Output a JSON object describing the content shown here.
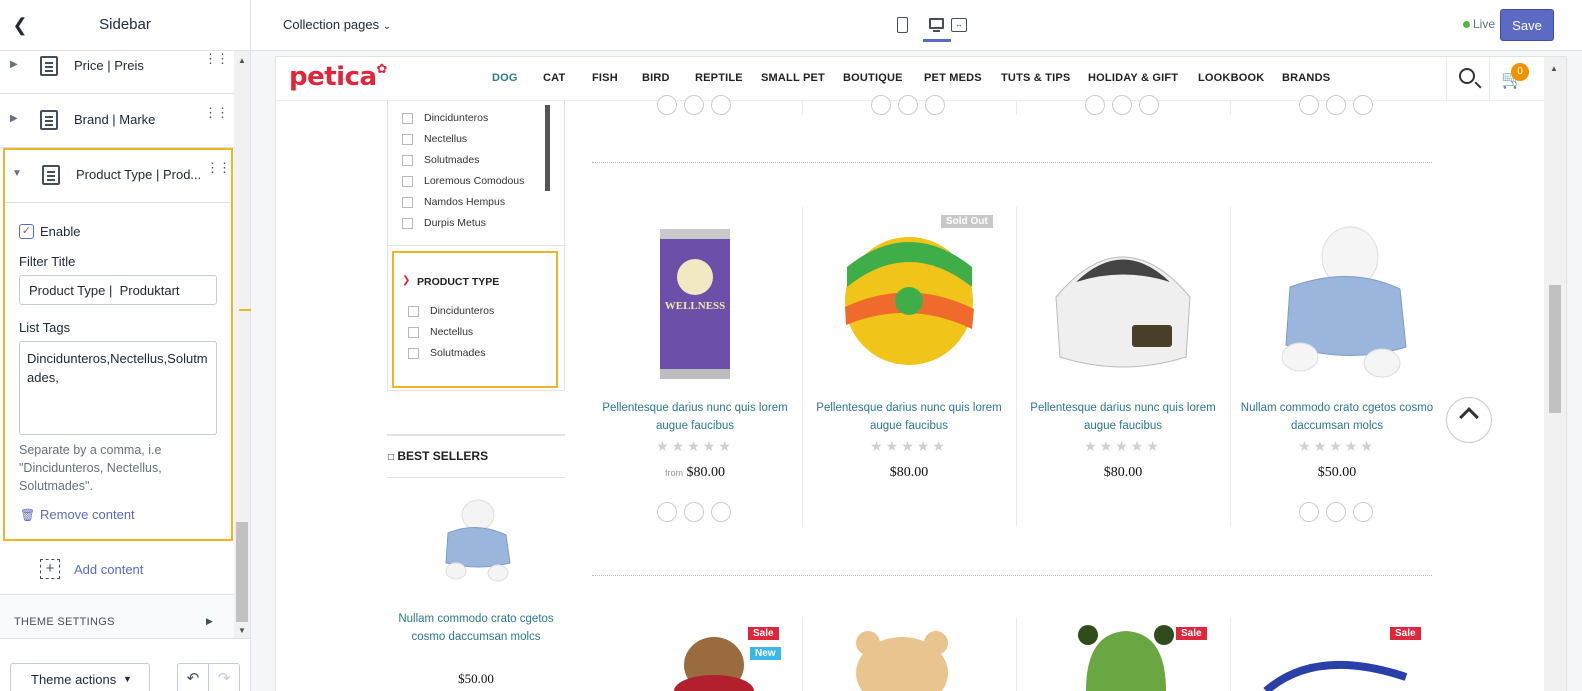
{
  "sidebar": {
    "title": "Sidebar",
    "items": [
      {
        "label": "Price | Preis"
      },
      {
        "label": "Brand | Marke"
      },
      {
        "label": "Product Type | Prod..."
      }
    ],
    "enable_label": "Enable",
    "filter_title_label": "Filter Title",
    "filter_title_value": "Product Type |  Produktart",
    "list_tags_label": "List Tags",
    "list_tags_value": "Dincidunteros,Nectellus,Solutmades,",
    "help_text": "Separate by a comma, i.e \"Dincidunteros, Nectellus, Solutmades\".",
    "remove_content": "Remove content",
    "add_content": "Add content",
    "theme_settings": "THEME SETTINGS",
    "theme_actions": "Theme actions"
  },
  "topbar": {
    "page_select": "Collection pages",
    "live_label": "Live",
    "save_label": "Save"
  },
  "store": {
    "logo": "petica",
    "nav": [
      "DOG",
      "CAT",
      "FISH",
      "BIRD",
      "REPTILE",
      "SMALL PET",
      "BOUTIQUE",
      "PET MEDS",
      "TUTS & TIPS",
      "HOLIDAY & GIFT",
      "LOOKBOOK",
      "BRANDS"
    ],
    "cart_count": "0",
    "filter_list": [
      "Dincidunteros",
      "Nectellus",
      "Solutmades",
      "Loremous Comodous",
      "Namdos Hempus",
      "Durpis Metus"
    ],
    "product_type_title": "PRODUCT TYPE",
    "product_type_list": [
      "Dincidunteros",
      "Nectellus",
      "Solutmades"
    ],
    "best_sellers_title": "BEST SELLERS",
    "best_seller": {
      "name": "Nullam commodo crato cgetos cosmo daccumsan molcs",
      "price": "$50.00"
    },
    "products": [
      {
        "name": "Pellentesque darius nunc quis lorem augue faucibus",
        "from": "from",
        "price": "$80.00",
        "badge": ""
      },
      {
        "name": "Pellentesque darius nunc quis lorem augue faucibus",
        "from": "",
        "price": "$80.00",
        "badge": "Sold Out"
      },
      {
        "name": "Pellentesque darius nunc quis lorem augue faucibus",
        "from": "",
        "price": "$80.00",
        "badge": ""
      },
      {
        "name": "Nullam commodo crato cgetos cosmo daccumsan molcs",
        "from": "",
        "price": "$50.00",
        "badge": ""
      }
    ],
    "badges": {
      "sale": "Sale",
      "new": "New"
    },
    "colors": {
      "brand_red": "#e0263a",
      "nav_active": "#2b7a8c",
      "link_teal": "#2b7a8c",
      "highlight": "#f0b429",
      "accent": "#5c6ac4"
    }
  }
}
